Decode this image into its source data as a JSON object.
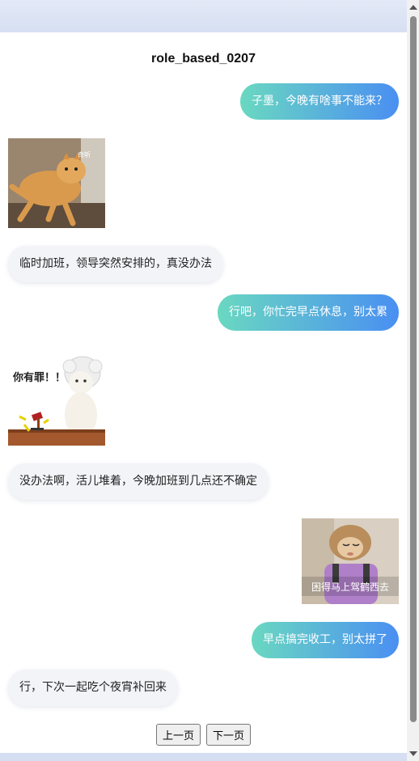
{
  "page": {
    "title": "role_based_0207"
  },
  "messages": [
    {
      "side": "right",
      "type": "text",
      "text": "子墨，今晚有啥事不能来？"
    },
    {
      "side": "left",
      "type": "sticker",
      "caption": "奇听",
      "icon": "running-cat-sticker"
    },
    {
      "side": "left",
      "type": "text",
      "text": "临时加班，领导突然安排的，真没办法"
    },
    {
      "side": "right",
      "type": "text",
      "text": "行吧，你忙完早点休息，别太累"
    },
    {
      "side": "left",
      "type": "sticker",
      "caption": "你有罪！！",
      "icon": "judge-cat-sticker"
    },
    {
      "side": "left",
      "type": "text",
      "text": "没办法啊，活儿堆着，今晚加班到几点还不确定"
    },
    {
      "side": "right",
      "type": "sticker",
      "caption": "困得马上驾鹤西去",
      "icon": "sleepy-monkey-sticker"
    },
    {
      "side": "right",
      "type": "text",
      "text": "早点搞完收工，别太拼了"
    },
    {
      "side": "left",
      "type": "text",
      "text": "行，下次一起吃个夜宵补回来"
    }
  ],
  "pager": {
    "prev_label": "上一页",
    "next_label": "下一页"
  },
  "colors": {
    "bubble_right_start": "#6ad8c1",
    "bubble_right_end": "#4a8ff2",
    "bubble_left": "#f2f4f8"
  }
}
